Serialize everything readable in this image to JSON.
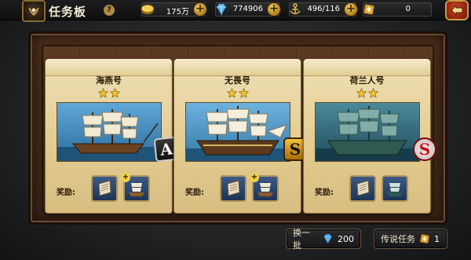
{
  "header": {
    "title": "任务板",
    "help_label": "?",
    "emblem_icon": "pirate-emblem-icon"
  },
  "resources": [
    {
      "icon": "gold-coin-icon",
      "value": "175万"
    },
    {
      "icon": "diamond-icon",
      "value": "774906"
    },
    {
      "icon": "anchor-icon",
      "value": "496/116"
    },
    {
      "icon": "legend-token-icon",
      "value": "0"
    }
  ],
  "cards": [
    {
      "name": "海燕号",
      "stars": 2,
      "grade": "A",
      "reward_label": "奖励:",
      "reward_icons": [
        "scroll-icon",
        "ship-icon"
      ]
    },
    {
      "name": "无畏号",
      "stars": 2,
      "grade": "S",
      "reward_label": "奖励:",
      "reward_icons": [
        "scroll-icon",
        "ship-icon"
      ]
    },
    {
      "name": "荷兰人号",
      "stars": 2,
      "grade": "S",
      "reward_label": "奖励:",
      "reward_icons": [
        "scroll-icon",
        "ship-icon"
      ]
    }
  ],
  "buttons": {
    "refresh": {
      "label": "换一批",
      "icon": "diamond-icon",
      "cost": "200"
    },
    "legend": {
      "label": "传说任务",
      "icon": "legend-token-icon",
      "cost": "1"
    }
  },
  "colors": {
    "parchment": "#e8d5a2",
    "board_wood": "#4a2e1a",
    "accent_gold": "#c89a4a",
    "back_red": "#b0301a"
  }
}
